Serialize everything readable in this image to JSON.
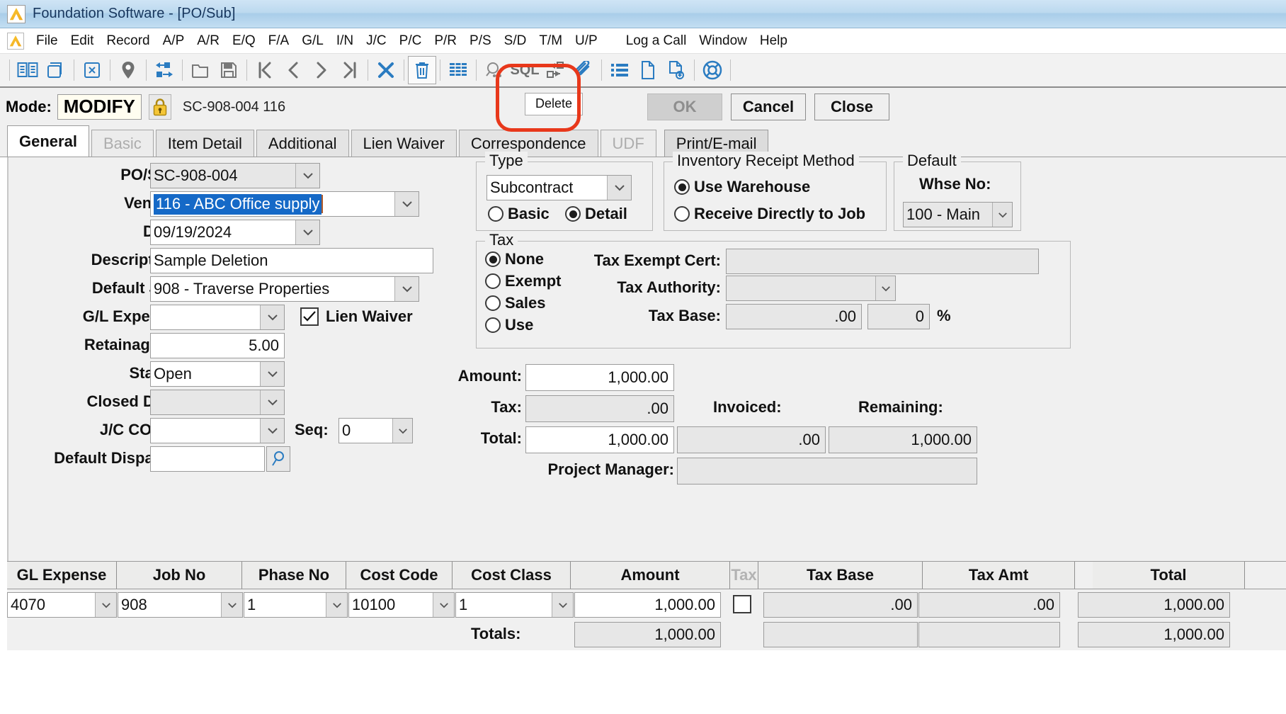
{
  "window": {
    "title": "Foundation Software - [PO/Sub]",
    "app_icon": "foundation-logo-icon"
  },
  "menubar": {
    "items": [
      "File",
      "Edit",
      "Record",
      "A/P",
      "A/R",
      "E/Q",
      "F/A",
      "G/L",
      "I/N",
      "J/C",
      "P/C",
      "P/R",
      "P/S",
      "S/D",
      "T/M",
      "U/P"
    ],
    "right_items": [
      "Log a Call",
      "Window",
      "Help"
    ]
  },
  "toolbar": {
    "tooltip": "Delete",
    "icons": [
      "book-icon",
      "copy-icon",
      "close-record-icon",
      "location-pin-icon",
      "transfer-icon",
      "new-folder-icon",
      "save-icon",
      "first-record-icon",
      "previous-record-icon",
      "next-record-icon",
      "last-record-icon",
      "cancel-x-icon",
      "delete-trash-icon",
      "list-grid-icon",
      "search-icon",
      "sql-icon",
      "workflow-icon",
      "attachment-icon",
      "bullet-list-icon",
      "document-icon",
      "add-document-icon",
      "help-lifering-icon"
    ]
  },
  "modebar": {
    "mode_label": "Mode:",
    "mode_value": "MODIFY",
    "lock_icon": "lock-icon",
    "record_id": "SC-908-004  116",
    "buttons": {
      "ok": "OK",
      "cancel": "Cancel",
      "close": "Close"
    }
  },
  "tabs": [
    {
      "label": "General",
      "state": "active"
    },
    {
      "label": "Basic",
      "state": "disabled"
    },
    {
      "label": "Item Detail",
      "state": "normal"
    },
    {
      "label": "Additional",
      "state": "normal"
    },
    {
      "label": "Lien Waiver",
      "state": "normal"
    },
    {
      "label": "Correspondence",
      "state": "normal"
    },
    {
      "label": "UDF",
      "state": "disabled"
    },
    {
      "label": "Print/E-mail",
      "state": "raised"
    }
  ],
  "form": {
    "po_sub": {
      "label": "PO/Sub:",
      "value": "SC-908-004"
    },
    "vendor": {
      "label": "Vendor:",
      "value": "116  - ABC Office supply",
      "selected": true
    },
    "date": {
      "label": "Date:",
      "value": "09/19/2024"
    },
    "description": {
      "label": "Description:",
      "value": "Sample Deletion"
    },
    "default_job": {
      "label": "Default Job:",
      "value": "908  - Traverse Properties"
    },
    "gl_expense": {
      "label": "G/L Expense:",
      "value": ""
    },
    "lien_waiver": {
      "label": "Lien Waiver",
      "checked": true
    },
    "retainage": {
      "label": "Retainage %:",
      "value": "5.00"
    },
    "status": {
      "label": "Status:",
      "value": "Open"
    },
    "closed_date": {
      "label": "Closed Date:",
      "value": ""
    },
    "jc_co_no": {
      "label": "J/C CO No:",
      "value": ""
    },
    "seq": {
      "label": "Seq:",
      "value": "0"
    },
    "default_dispatch": {
      "label": "Default Dispatch:",
      "value": "",
      "button_icon": "magnifier-icon"
    }
  },
  "type_group": {
    "title": "Type",
    "value": "Subcontract",
    "options": [
      {
        "label": "Basic",
        "selected": false
      },
      {
        "label": "Detail",
        "selected": true
      }
    ]
  },
  "inventory_group": {
    "title": "Inventory Receipt Method",
    "options": [
      {
        "label": "Use Warehouse",
        "selected": true
      },
      {
        "label": "Receive Directly to Job",
        "selected": false
      }
    ]
  },
  "default_group": {
    "title": "Default",
    "label": "Whse No:",
    "value": "100  - Main"
  },
  "tax_group": {
    "title": "Tax",
    "options": [
      {
        "label": "None",
        "selected": true
      },
      {
        "label": "Exempt",
        "selected": false
      },
      {
        "label": "Sales",
        "selected": false
      },
      {
        "label": "Use",
        "selected": false
      }
    ],
    "exempt_cert": {
      "label": "Tax Exempt Cert:",
      "value": ""
    },
    "authority": {
      "label": "Tax Authority:",
      "value": ""
    },
    "tax_base": {
      "label": "Tax Base:",
      "value": ".00",
      "pct_value": "0",
      "pct_symbol": "%"
    }
  },
  "amounts": {
    "amount": {
      "label": "Amount:",
      "value": "1,000.00"
    },
    "tax": {
      "label": "Tax:",
      "value": ".00"
    },
    "total": {
      "label": "Total:",
      "value": "1,000.00"
    },
    "invoiced": {
      "label": "Invoiced:",
      "value": ".00"
    },
    "remaining": {
      "label": "Remaining:",
      "value": "1,000.00"
    },
    "project_manager": {
      "label": "Project Manager:",
      "value": ""
    }
  },
  "grid": {
    "columns": [
      "GL Expense",
      "Job No",
      "Phase No",
      "Cost Code",
      "Cost Class",
      "Amount",
      "Tax",
      "Tax Base",
      "Tax Amt",
      "Total"
    ],
    "rows": [
      {
        "gl_expense": "4070",
        "job_no": "908",
        "phase_no": "1",
        "cost_code": "10100",
        "cost_class": "1",
        "amount": "1,000.00",
        "tax_checked": false,
        "tax_base": ".00",
        "tax_amt": ".00",
        "total": "1,000.00"
      }
    ],
    "totals": {
      "label": "Totals:",
      "amount": "1,000.00",
      "tax_base": "",
      "tax_amt": "",
      "total": "1,000.00"
    }
  },
  "colors": {
    "accent_blue": "#2b7cc1",
    "selection_blue": "#1569c7",
    "annotation_red": "#e8381b",
    "titlebar_blue": "#a9cde9"
  }
}
